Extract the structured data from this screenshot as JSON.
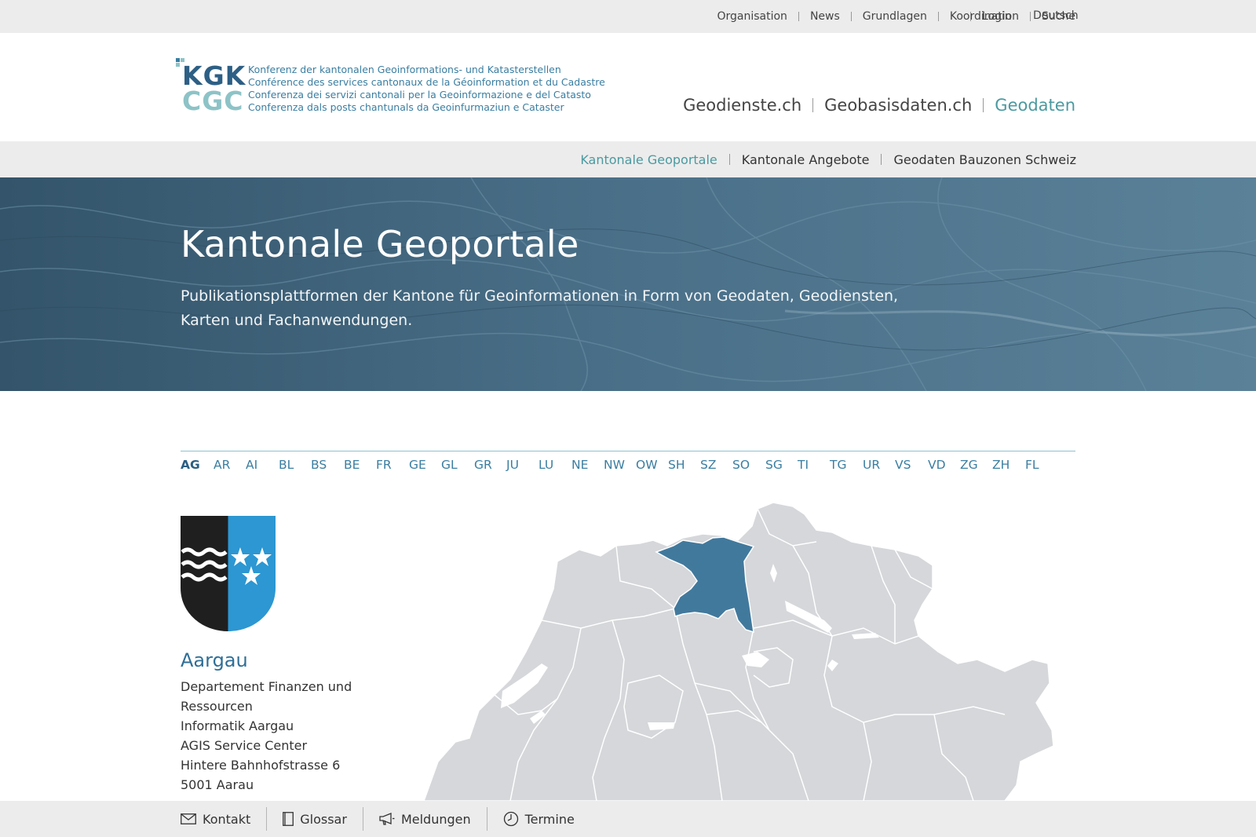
{
  "topbar": {
    "links": [
      "Organisation",
      "News",
      "Grundlagen",
      "Koordination",
      "Suche"
    ],
    "login": "Login",
    "language": "Deutsch"
  },
  "logo": {
    "line1": "KGK",
    "line2": "CGC",
    "text": [
      "Konferenz der kantonalen Geoinformations- und Katasterstellen",
      "Conférence des services cantonaux de la Géoinformation et du Cadastre",
      "Conferenza dei servizi cantonali per la Geoinformazione e del Catasto",
      "Conferenza dals posts chantunals da Geoinfurmaziun e Cataster"
    ]
  },
  "portals": [
    "Geodienste.ch",
    "Geobasisdaten.ch",
    "Geodaten"
  ],
  "subnav": [
    "Kantonale Geoportale",
    "Kantonale Angebote",
    "Geodaten Bauzonen Schweiz"
  ],
  "hero": {
    "title": "Kantonale Geoportale",
    "text": "Publikationsplattformen der Kantone für Geoinformationen in Form von Geodaten, Geodiensten, Karten und Fachanwendungen."
  },
  "cantons": [
    "AG",
    "AR",
    "AI",
    "BL",
    "BS",
    "BE",
    "FR",
    "GE",
    "GL",
    "GR",
    "JU",
    "LU",
    "NE",
    "NW",
    "OW",
    "SH",
    "SZ",
    "SO",
    "SG",
    "TI",
    "TG",
    "UR",
    "VS",
    "VD",
    "ZG",
    "ZH",
    "FL"
  ],
  "selected": {
    "name": "Aargau",
    "address": [
      "Departement Finanzen und",
      "Ressourcen",
      "Informatik Aargau",
      "AGIS Service Center",
      "Hintere Bahnhofstrasse 6",
      "5001 Aarau"
    ]
  },
  "footer": [
    "Kontakt",
    "Glossar",
    "Meldungen",
    "Termine"
  ],
  "colors": {
    "accent": "#4a9aa0",
    "link": "#3a7ea1",
    "highlight_canton": "#41799d",
    "map_fill": "#d5d7da",
    "hero_bg": "#41667f"
  }
}
